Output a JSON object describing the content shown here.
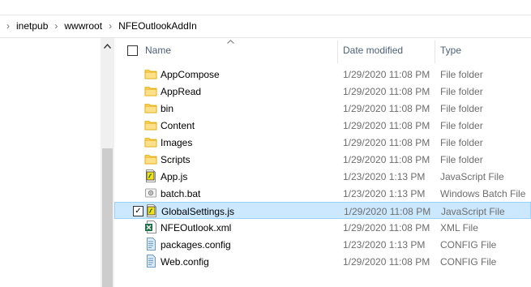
{
  "breadcrumb": {
    "items": [
      "inetpub",
      "wwwroot",
      "NFEOutlookAddIn"
    ],
    "separator": "›"
  },
  "columns": {
    "name": "Name",
    "date_modified": "Date modified",
    "type": "Type"
  },
  "files": [
    {
      "name": "AppCompose",
      "date": "1/29/2020 11:08 PM",
      "type": "File folder",
      "icon": "folder-icon"
    },
    {
      "name": "AppRead",
      "date": "1/29/2020 11:08 PM",
      "type": "File folder",
      "icon": "folder-icon"
    },
    {
      "name": "bin",
      "date": "1/29/2020 11:08 PM",
      "type": "File folder",
      "icon": "folder-icon"
    },
    {
      "name": "Content",
      "date": "1/29/2020 11:08 PM",
      "type": "File folder",
      "icon": "folder-icon"
    },
    {
      "name": "Images",
      "date": "1/29/2020 11:08 PM",
      "type": "File folder",
      "icon": "folder-icon"
    },
    {
      "name": "Scripts",
      "date": "1/29/2020 11:08 PM",
      "type": "File folder",
      "icon": "folder-icon"
    },
    {
      "name": "App.js",
      "date": "1/23/2020 1:13 PM",
      "type": "JavaScript File",
      "icon": "javascript-file-icon"
    },
    {
      "name": "batch.bat",
      "date": "1/23/2020 1:13 PM",
      "type": "Windows Batch File",
      "icon": "batch-file-icon"
    },
    {
      "name": "GlobalSettings.js",
      "date": "1/29/2020 11:08 PM",
      "type": "JavaScript File",
      "icon": "javascript-file-icon",
      "selected": true
    },
    {
      "name": "NFEOutlook.xml",
      "date": "1/29/2020 11:08 PM",
      "type": "XML File",
      "icon": "xml-file-icon"
    },
    {
      "name": "packages.config",
      "date": "1/23/2020 1:13 PM",
      "type": "CONFIG File",
      "icon": "config-file-icon"
    },
    {
      "name": "Web.config",
      "date": "1/29/2020 11:08 PM",
      "type": "CONFIG File",
      "icon": "config-file-icon"
    }
  ],
  "colors": {
    "selection_bg": "#cce8ff",
    "selection_border": "#99d1ff",
    "header_text": "#4c607a",
    "folder_yellow": "#ffd766"
  }
}
